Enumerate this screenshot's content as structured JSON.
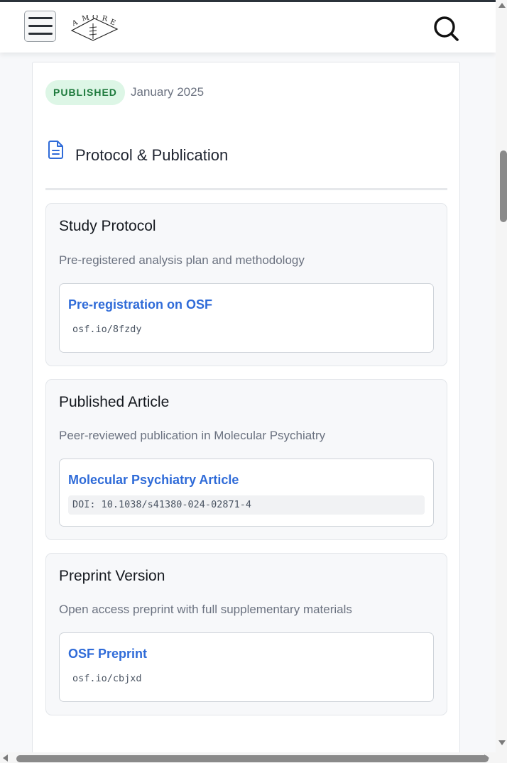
{
  "header": {
    "menu_icon": "hamburger-menu-icon",
    "logo_text": "AMORE",
    "search_icon": "search-icon"
  },
  "status": {
    "badge": "PUBLISHED",
    "date": "January 2025"
  },
  "section": {
    "icon": "document-icon",
    "title": "Protocol & Publication"
  },
  "cards": [
    {
      "title": "Study Protocol",
      "description": "Pre-registered analysis plan and methodology",
      "link_label": "Pre-registration on OSF",
      "link_detail": "osf.io/8fzdy"
    },
    {
      "title": "Published Article",
      "description": "Peer-reviewed publication in Molecular Psychiatry",
      "link_label": "Molecular Psychiatry Article",
      "link_detail": "DOI: 10.1038/s41380-024-02871-4"
    },
    {
      "title": "Preprint Version",
      "description": "Open access preprint with full supplementary materials",
      "link_label": "OSF Preprint",
      "link_detail": "osf.io/cbjxd"
    }
  ],
  "colors": {
    "link": "#2f6bd8",
    "badge_bg": "#ddf6e6",
    "badge_text": "#1e7a3d"
  }
}
